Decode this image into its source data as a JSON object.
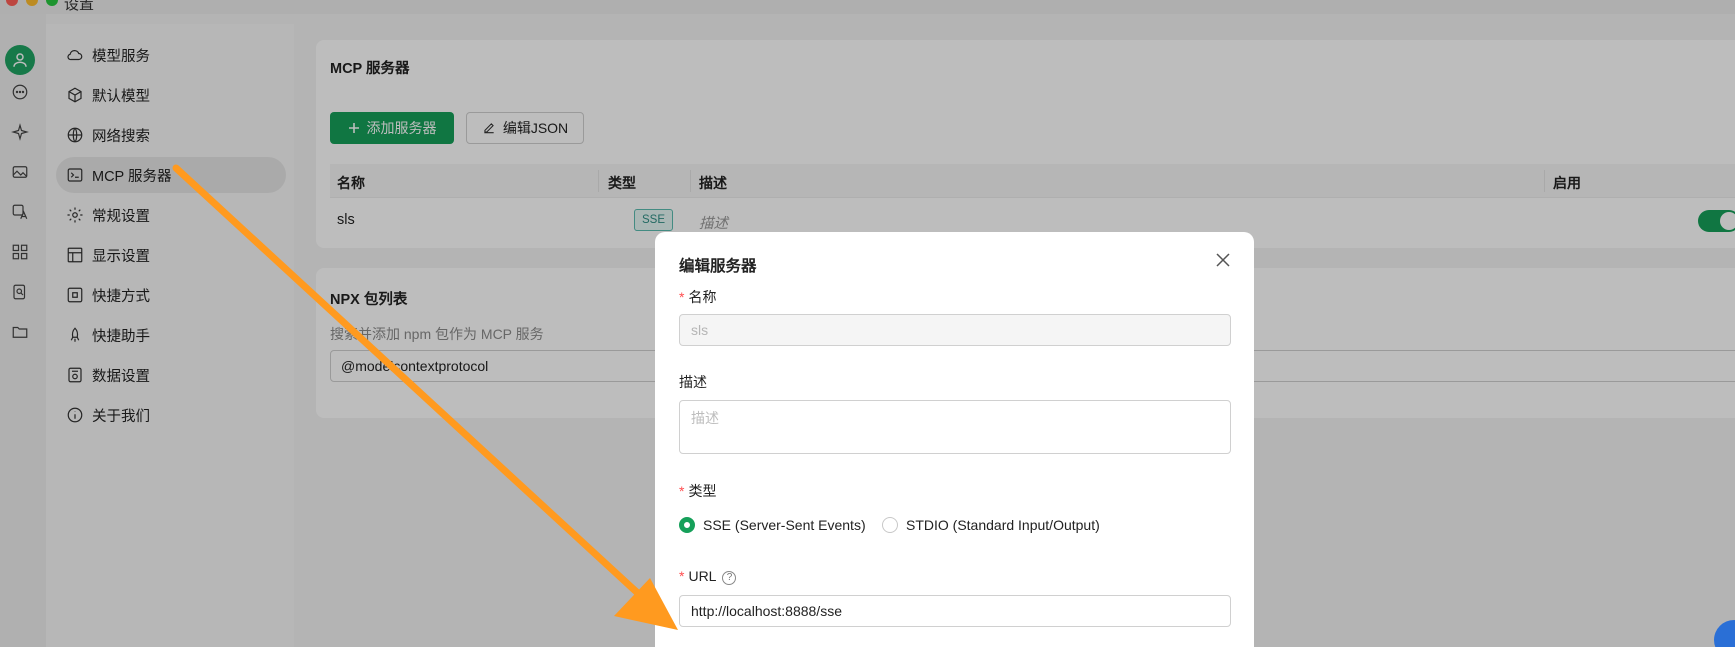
{
  "window": {
    "title": "设置"
  },
  "nav": {
    "items": [
      {
        "label": "模型服务",
        "icon": "cloud-icon"
      },
      {
        "label": "默认模型",
        "icon": "cube-icon"
      },
      {
        "label": "网络搜索",
        "icon": "globe-icon"
      },
      {
        "label": "MCP 服务器",
        "icon": "terminal-icon",
        "active": true
      },
      {
        "label": "常规设置",
        "icon": "gear-icon"
      },
      {
        "label": "显示设置",
        "icon": "layout-icon"
      },
      {
        "label": "快捷方式",
        "icon": "command-icon"
      },
      {
        "label": "快捷助手",
        "icon": "rocket-icon"
      },
      {
        "label": "数据设置",
        "icon": "database-icon"
      },
      {
        "label": "关于我们",
        "icon": "info-icon"
      }
    ]
  },
  "mcp": {
    "title": "MCP 服务器",
    "add_label": "添加服务器",
    "edit_json_label": "编辑JSON",
    "columns": {
      "name": "名称",
      "type": "类型",
      "desc": "描述",
      "enabled": "启用"
    },
    "rows": [
      {
        "name": "sls",
        "type": "SSE",
        "desc": "描述",
        "enabled": true
      }
    ]
  },
  "npx": {
    "title": "NPX 包列表",
    "hint": "搜索并添加 npm 包作为 MCP 服务",
    "search_value": "@modelcontextprotocol"
  },
  "modal": {
    "title": "编辑服务器",
    "name_label": "名称",
    "name_value": "sls",
    "desc_label": "描述",
    "desc_placeholder": "描述",
    "type_label": "类型",
    "type_options": [
      "SSE (Server-Sent Events)",
      "STDIO (Standard Input/Output)"
    ],
    "type_selected": "SSE (Server-Sent Events)",
    "url_label": "URL",
    "url_help": "?",
    "url_value": "http://localhost:8888/sse",
    "required_mark": "*"
  },
  "colors": {
    "accent": "#16a05a",
    "arrow": "#ff9a1f",
    "badge": "#2f8f85"
  }
}
